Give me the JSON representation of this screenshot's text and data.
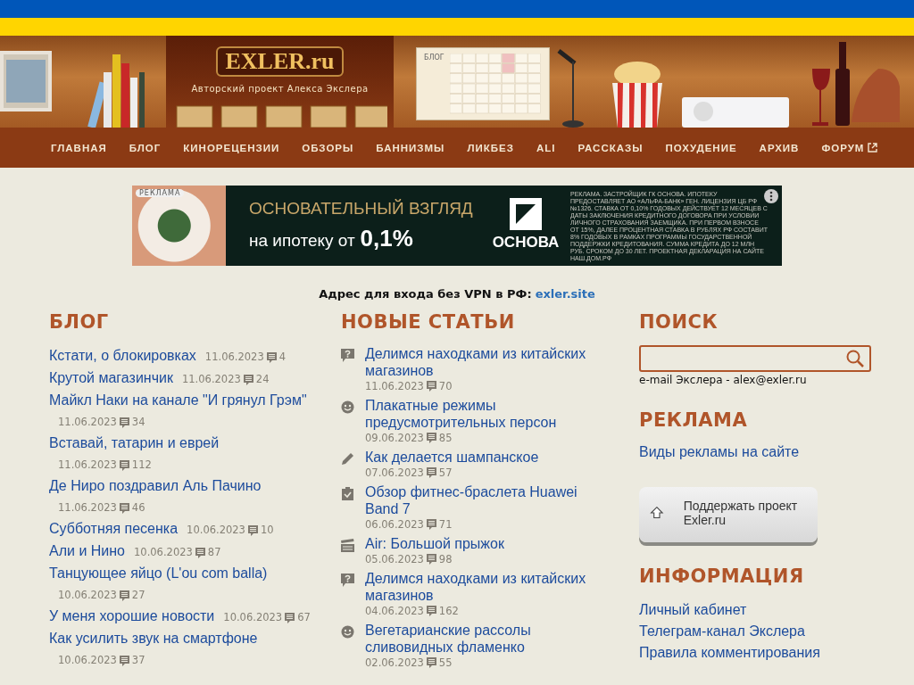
{
  "header": {
    "logo": "EXLER.ru",
    "tagline": "Авторский проект Алекса Экслера",
    "calendar_label": "БЛОГ"
  },
  "nav": [
    {
      "label": "ГЛАВНАЯ",
      "external": false
    },
    {
      "label": "БЛОГ",
      "external": false
    },
    {
      "label": "КИНОРЕЦЕНЗИИ",
      "external": false
    },
    {
      "label": "ОБЗОРЫ",
      "external": false
    },
    {
      "label": "БАННИЗМЫ",
      "external": false
    },
    {
      "label": "ЛИКБЕЗ",
      "external": false
    },
    {
      "label": "ALI",
      "external": false
    },
    {
      "label": "РАССКАЗЫ",
      "external": false
    },
    {
      "label": "ПОХУДЕНИЕ",
      "external": false
    },
    {
      "label": "АРХИВ",
      "external": false
    },
    {
      "label": "ФОРУМ",
      "external": true
    }
  ],
  "ad": {
    "badge": "РЕКЛАМА",
    "headline": "ОСНОВАТЕЛЬНЫЙ ВЗГЛЯД",
    "subline": "на ипотеку от",
    "rate": "0,1%",
    "brand": "ОСНОВА",
    "disclaimer": "РЕКЛАМА. ЗАСТРОЙЩИК ГК ОСНОВА. ИПОТЕКУ ПРЕДОСТАВЛЯЕТ АО «АЛЬФА-БАНК» ГЕН. ЛИЦЕНЗИЯ ЦБ РФ №1326. СТАВКА ОТ 0,10% ГОДОВЫХ ДЕЙСТВУЕТ 12 МЕСЯЦЕВ С ДАТЫ ЗАКЛЮЧЕНИЯ КРЕДИТНОГО ДОГОВОРА ПРИ УСЛОВИИ ЛИЧНОГО СТРАХОВАНИЯ ЗАЕМЩИКА. ПРИ ПЕРВОМ ВЗНОСЕ ОТ 15%, ДАЛЕЕ ПРОЦЕНТНАЯ СТАВКА В РУБЛЯХ РФ СОСТАВИТ 8% ГОДОВЫХ В РАМКАХ ПРОГРАММЫ ГОСУДАРСТВЕННОЙ ПОДДЕРЖКИ КРЕДИТОВАНИЯ. СУММА КРЕДИТА ДО 12 МЛН РУБ. СРОКОМ ДО 30 ЛЕТ. ПРОЕКТНАЯ ДЕКЛАРАЦИЯ НА САЙТЕ НАШ.ДОМ.РФ"
  },
  "vpn": {
    "label": "Адрес для входа без VPN в РФ:",
    "link": "exler.site"
  },
  "blog": {
    "title": "БЛОГ",
    "posts": [
      {
        "title": "Кстати, о блокировках",
        "date": "11.06.2023",
        "comments": "4"
      },
      {
        "title": "Крутой магазинчик",
        "date": "11.06.2023",
        "comments": "24"
      },
      {
        "title": "Майкл Наки на канале \"И грянул Грэм\"",
        "date": "11.06.2023",
        "comments": "34"
      },
      {
        "title": "Вставай, татарин и еврей",
        "date": "11.06.2023",
        "comments": "112"
      },
      {
        "title": "Де Ниро поздравил Аль Пачино",
        "date": "11.06.2023",
        "comments": "46"
      },
      {
        "title": "Субботняя песенка",
        "date": "10.06.2023",
        "comments": "10"
      },
      {
        "title": "Али и Нино",
        "date": "10.06.2023",
        "comments": "87"
      },
      {
        "title": "Танцующее яйцо (L'ou com balla)",
        "date": "10.06.2023",
        "comments": "27"
      },
      {
        "title": "У меня хорошие новости",
        "date": "10.06.2023",
        "comments": "67"
      },
      {
        "title": "Как усилить звук на смартфоне",
        "date": "10.06.2023",
        "comments": "37"
      }
    ]
  },
  "articles": {
    "title": "НОВЫЕ СТАТЬИ",
    "items": [
      {
        "kind": "question",
        "title": "Делимся находками из китайских магазинов",
        "date": "11.06.2023",
        "comments": "70"
      },
      {
        "kind": "smile",
        "title": "Плакатные режимы предусмотрительных персон",
        "date": "09.06.2023",
        "comments": "85"
      },
      {
        "kind": "pencil",
        "title": "Как делается шампанское",
        "date": "07.06.2023",
        "comments": "57"
      },
      {
        "kind": "review",
        "title": "Обзор фитнес-браслета Huawei Band 7",
        "date": "06.06.2023",
        "comments": "71"
      },
      {
        "kind": "film",
        "title": "Air: Большой прыжок",
        "date": "05.06.2023",
        "comments": "98"
      },
      {
        "kind": "question",
        "title": "Делимся находками из китайских магазинов",
        "date": "04.06.2023",
        "comments": "162"
      },
      {
        "kind": "smile",
        "title": "Вегетарианские рассолы сливовидных фламенко",
        "date": "02.06.2023",
        "comments": "55"
      }
    ]
  },
  "sidebar": {
    "search_title": "ПОИСК",
    "email": "e-mail Экслера - alex@exler.ru",
    "ads_title": "РЕКЛАМА",
    "ads_link": "Виды рекламы на сайте",
    "support_button": "Поддержать проект Exler.ru",
    "info_title": "ИНФОРМАЦИЯ",
    "info_links": [
      "Личный кабинет",
      "Телеграм-канал Экслера",
      "Правила комментирования"
    ]
  }
}
